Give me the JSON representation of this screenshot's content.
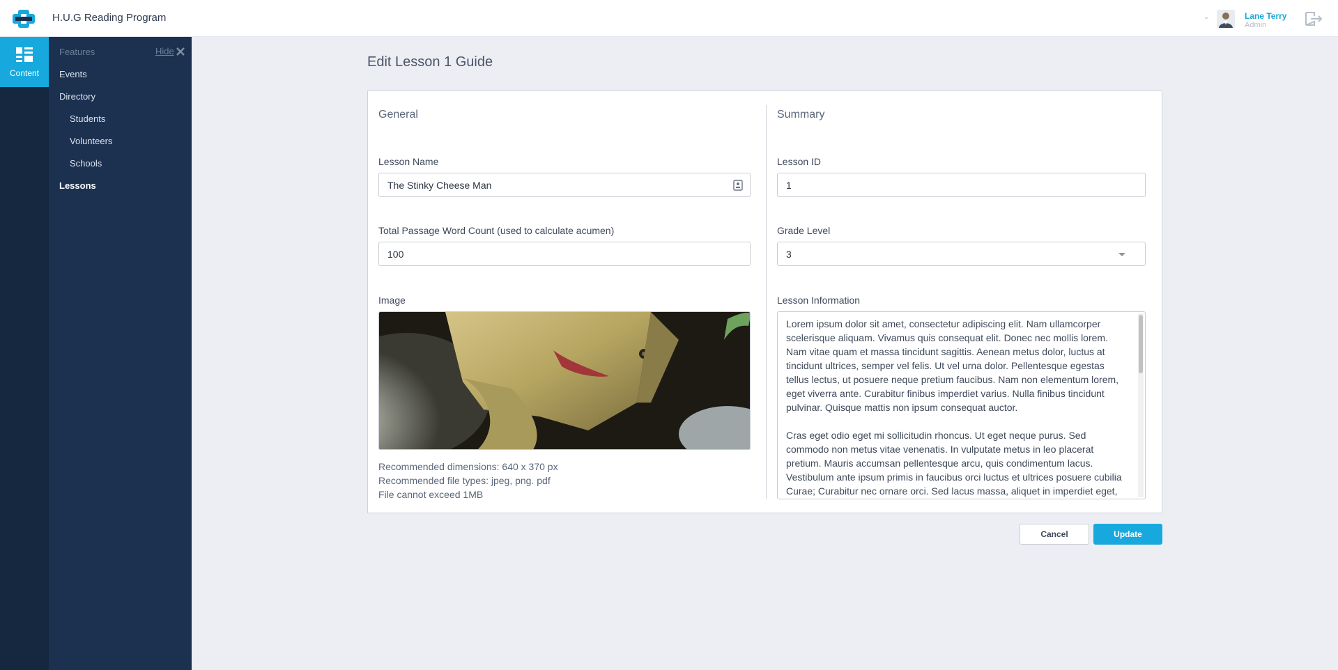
{
  "app": {
    "title": "H.U.G Reading Program"
  },
  "user": {
    "name": "Lane Terry",
    "role": "Admin"
  },
  "rail": {
    "content_label": "Content"
  },
  "sidebar": {
    "header": "Features",
    "hide_label": "Hide",
    "items": [
      {
        "label": "Events"
      },
      {
        "label": "Directory"
      },
      {
        "label": "Students"
      },
      {
        "label": "Volunteers"
      },
      {
        "label": "Schools"
      },
      {
        "label": "Lessons"
      }
    ]
  },
  "page": {
    "title": "Edit Lesson 1 Guide"
  },
  "general": {
    "title": "General",
    "lesson_name_label": "Lesson Name",
    "lesson_name_value": "The Stinky Cheese Man",
    "word_count_label": "Total Passage Word Count (used to calculate acumen)",
    "word_count_value": "100",
    "image_label": "Image",
    "hints": [
      "Recommended dimensions: 640 x 370 px",
      "Recommended file types: jpeg, png. pdf",
      "File cannot exceed 1MB"
    ]
  },
  "summary": {
    "title": "Summary",
    "lesson_id_label": "Lesson ID",
    "lesson_id_value": "1",
    "grade_level_label": "Grade Level",
    "grade_level_value": "3",
    "lesson_info_label": "Lesson Information",
    "lesson_info_paragraphs": [
      "Lorem ipsum dolor sit amet, consectetur adipiscing elit. Nam ullamcorper scelerisque aliquam. Vivamus quis consequat elit. Donec nec mollis lorem. Nam vitae quam et massa tincidunt sagittis. Aenean metus dolor, luctus at tincidunt ultrices, semper vel felis. Ut vel urna dolor. Pellentesque egestas tellus lectus, ut posuere neque pretium faucibus. Nam non elementum lorem, eget viverra ante. Curabitur finibus imperdiet varius. Nulla finibus tincidunt pulvinar. Quisque mattis non ipsum consequat auctor.",
      "Cras eget odio eget mi sollicitudin rhoncus. Ut eget neque purus. Sed commodo non metus vitae venenatis. In vulputate metus in leo placerat pretium. Mauris accumsan pellentesque arcu, quis condimentum lacus. Vestibulum ante ipsum primis in faucibus orci luctus et ultrices posuere cubilia Curae; Curabitur nec ornare orci. Sed lacus massa, aliquet in imperdiet eget, commodo vel diam."
    ]
  },
  "actions": {
    "cancel_label": "Cancel",
    "update_label": "Update"
  },
  "colors": {
    "accent": "#17a9dd",
    "rail_bg": "#162740",
    "sidebar_bg": "#1c3150",
    "page_bg": "#eceef3"
  },
  "icons": [
    "app-logo-icon",
    "chevron-down-icon",
    "logout-icon",
    "content-grid-icon",
    "close-icon",
    "contact-card-icon",
    "select-caret-icon"
  ]
}
